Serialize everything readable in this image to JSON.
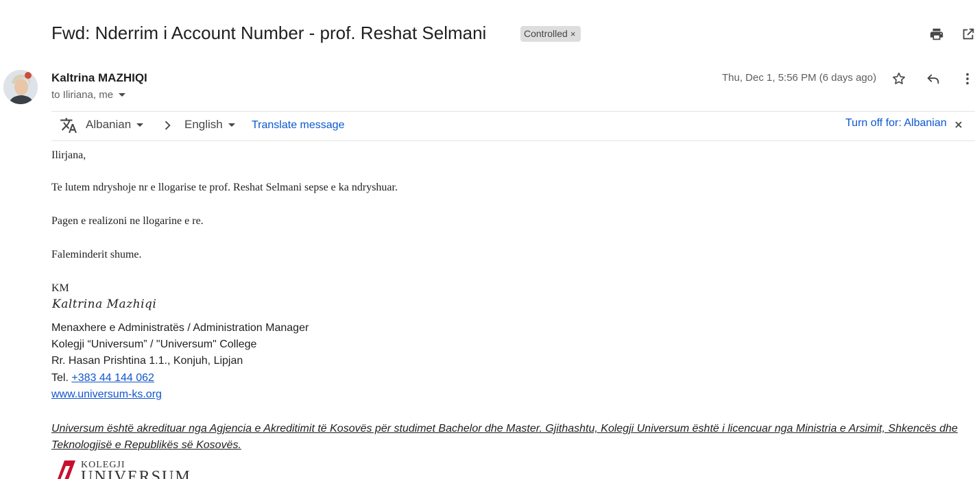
{
  "email": {
    "subject": "Fwd: Nderrim i Account Number - prof. Reshat Selmani",
    "label": "Controlled",
    "label_remove": "×",
    "sender_name": "Kaltrina MAZHIQI",
    "recipients": "to Iliriana, me",
    "date": "Thu, Dec 1, 5:56 PM (6 days ago)"
  },
  "translate_bar": {
    "source_lang": "Albanian",
    "target_lang": "English",
    "translate_link": "Translate message",
    "turn_off": "Turn off for: Albanian"
  },
  "body": {
    "greeting": "Ilirjana,",
    "line1": "Te lutem ndryshoje nr e llogarise te prof. Reshat Selmani sepse e ka ndryshuar.",
    "line2": "Pagen e realizoni ne llogarine e re.",
    "line3": "Faleminderit shume.",
    "initials": "KM"
  },
  "signature": {
    "script_name": "Kaltrina Mazhiqi",
    "title": "Menaxhere e Administratës / Administration Manager",
    "college": "Kolegji “Universum” / \"Universum\" College",
    "address": "Rr. Hasan Prishtina 1.1., Konjuh, Lipjan",
    "tel_prefix": "Tel.",
    "phone": "+383 44 144 062",
    "website": "www.universum-ks.org",
    "disclaimer": "Universum është akredituar nga Agjencia e Akreditimit të Kosovës për studimet Bachelor dhe Master. Gjithashtu, Kolegji Universum është i licencuar nga Ministria e Arsimit, Shkencës dhe Teknologjisë e Republikës së Kosovës.",
    "logo_small": "KOLEGJI",
    "logo_big": "UNIVERSUM"
  },
  "colors": {
    "link": "#0b57d0",
    "sig_link": "#1155cc",
    "logo_red": "#c8102e"
  },
  "icons": [
    "print-icon",
    "open-new-window-icon",
    "star-icon",
    "reply-icon",
    "more-vert-icon",
    "translate-icon",
    "chevron-right-icon",
    "close-icon"
  ]
}
